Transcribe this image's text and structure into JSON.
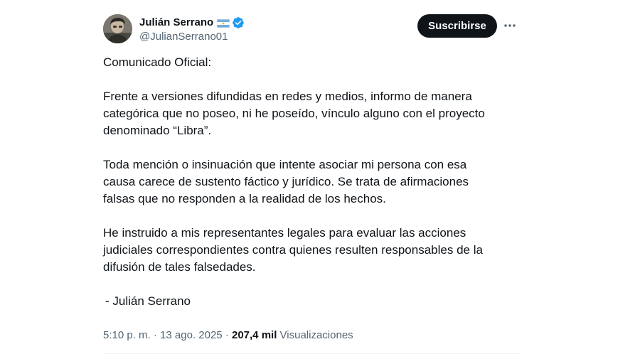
{
  "tweet": {
    "author": {
      "display_name": "Julián Serrano",
      "handle": "@JulianSerrano01",
      "flag_icon": "argentina-flag-icon",
      "verified_icon": "verified-badge-icon",
      "verified_color": "#1d9bf0"
    },
    "subscribe_label": "Suscribirse",
    "more_icon": "more-options-icon",
    "body": {
      "line1": "Comunicado Oficial:",
      "para1_line1": "Frente a versiones difundidas en redes y medios, informo de manera",
      "para1_line2": "categórica que no poseo, ni he poseído, vínculo alguno con el proyecto",
      "para1_line3": "denominado “Libra”.",
      "para2_line1": "Toda mención o insinuación que intente asociar mi persona con esa",
      "para2_line2": "causa carece de sustento fáctico y jurídico. Se trata de afirmaciones",
      "para2_line3": "falsas que no responden a la realidad de los hechos.",
      "para3_line1": "He instruido a mis representantes legales para evaluar las acciones",
      "para3_line2": "judiciales correspondientes contra quienes resulten responsables de la",
      "para3_line3": "difusión de tales falsedades.",
      "signature": "- Julián Serrano"
    },
    "meta": {
      "time": "5:10 p. m.",
      "separator": "·",
      "date": "13 ago. 2025",
      "views_count": "207,4 mil",
      "views_label": "Visualizaciones"
    }
  }
}
